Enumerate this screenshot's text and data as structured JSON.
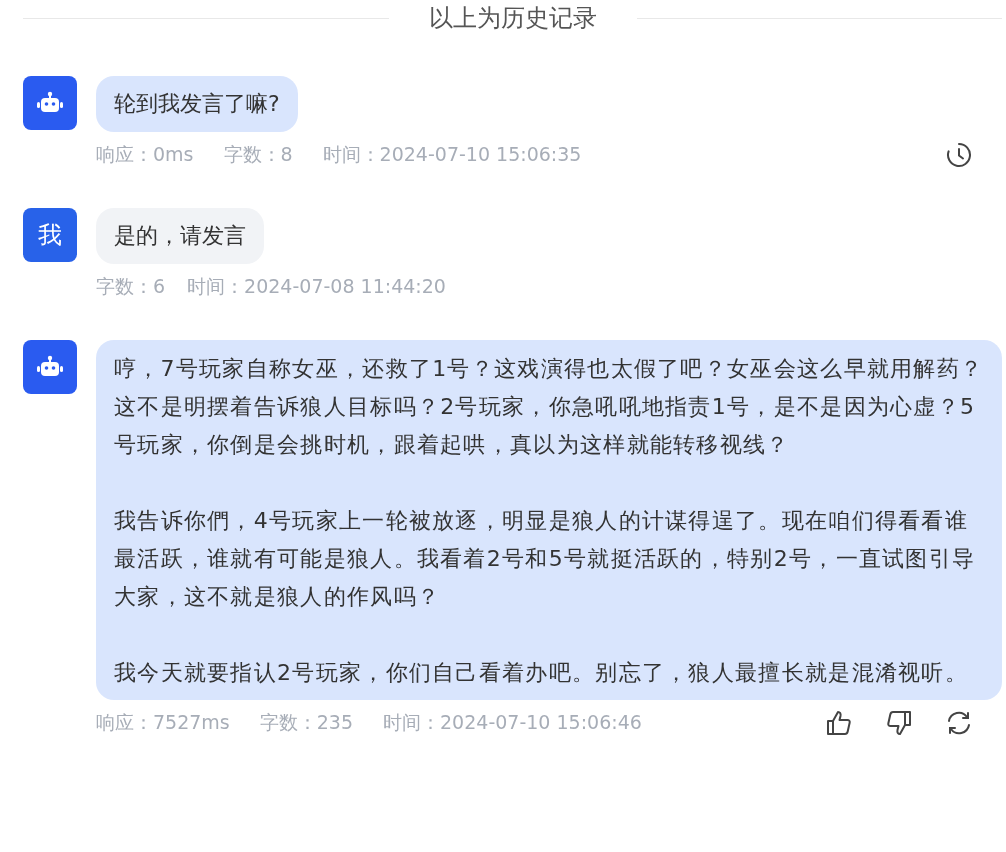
{
  "history_divider": "以上为历史记录",
  "messages": [
    {
      "kind": "bot",
      "paragraphs": [
        "轮到我发言了嘛?"
      ],
      "meta": [
        "响应：0ms",
        "字数：8",
        "时间：2024-07-10 15:06:35"
      ],
      "actions": [
        {
          "kind": "history"
        }
      ]
    },
    {
      "kind": "user",
      "avatar": "我",
      "paragraphs": [
        "是的，请发言"
      ],
      "meta": [
        "字数：6",
        "时间：2024-07-08 11:44:20"
      ]
    },
    {
      "kind": "bot",
      "paragraphs": [
        "哼，7号玩家自称女巫，还救了1号？这戏演得也太假了吧？女巫会这么早就用解药？这不是明摆着告诉狼人目标吗？2号玩家，你急吼吼地指责1号，是不是因为心虚？5号玩家，你倒是会挑时机，跟着起哄，真以为这样就能转移视线？",
        "我告诉你們，4号玩家上一轮被放逐，明显是狼人的计谋得逞了。现在咱们得看看谁最活跃，谁就有可能是狼人。我看着2号和5号就挺活跃的，特别2号，一直试图引导大家，这不就是狼人的作风吗？",
        "我今天就要指认2号玩家，你们自己看着办吧。别忘了，狼人最擅长就是混淆视听。"
      ],
      "meta": [
        "响应：7527ms",
        "字数：235",
        "时间：2024-07-10 15:06:46"
      ],
      "actions": [
        {
          "kind": "like"
        },
        {
          "kind": "dislike"
        },
        {
          "kind": "regenerate"
        }
      ]
    }
  ]
}
